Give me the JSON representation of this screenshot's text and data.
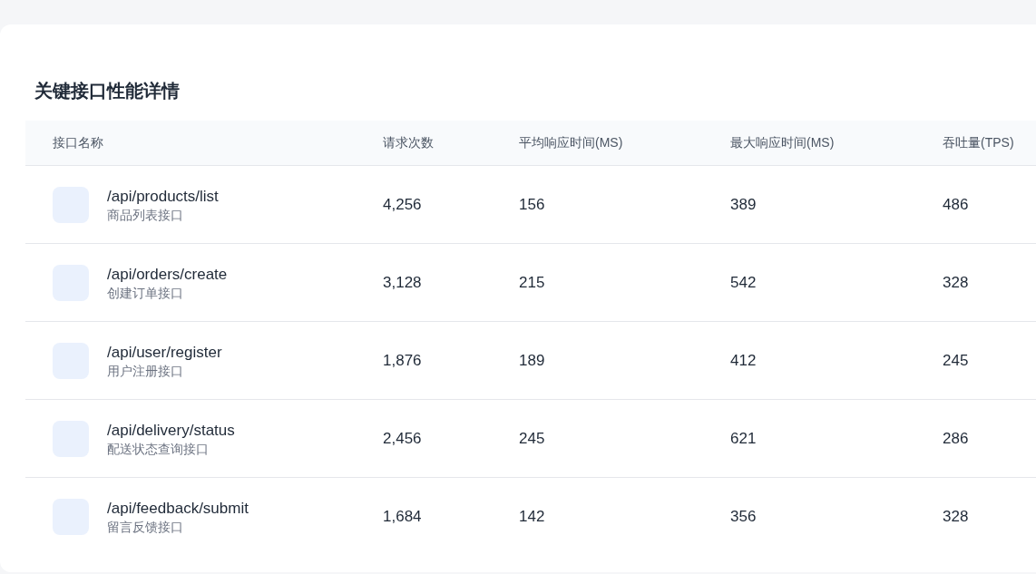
{
  "title": "关键接口性能详情",
  "table": {
    "columns": [
      "接口名称",
      "请求次数",
      "平均响应时间(MS)",
      "最大响应时间(MS)",
      "吞吐量(TPS)"
    ],
    "rows": [
      {
        "path": "/api/products/list",
        "description": "商品列表接口",
        "requests": "4,256",
        "avg": "156",
        "max": "389",
        "tps": "486"
      },
      {
        "path": "/api/orders/create",
        "description": "创建订单接口",
        "requests": "3,128",
        "avg": "215",
        "max": "542",
        "tps": "328"
      },
      {
        "path": "/api/user/register",
        "description": "用户注册接口",
        "requests": "1,876",
        "avg": "189",
        "max": "412",
        "tps": "245"
      },
      {
        "path": "/api/delivery/status",
        "description": "配送状态查询接口",
        "requests": "2,456",
        "avg": "245",
        "max": "621",
        "tps": "286"
      },
      {
        "path": "/api/feedback/submit",
        "description": "留言反馈接口",
        "requests": "1,684",
        "avg": "142",
        "max": "356",
        "tps": "328"
      }
    ]
  }
}
